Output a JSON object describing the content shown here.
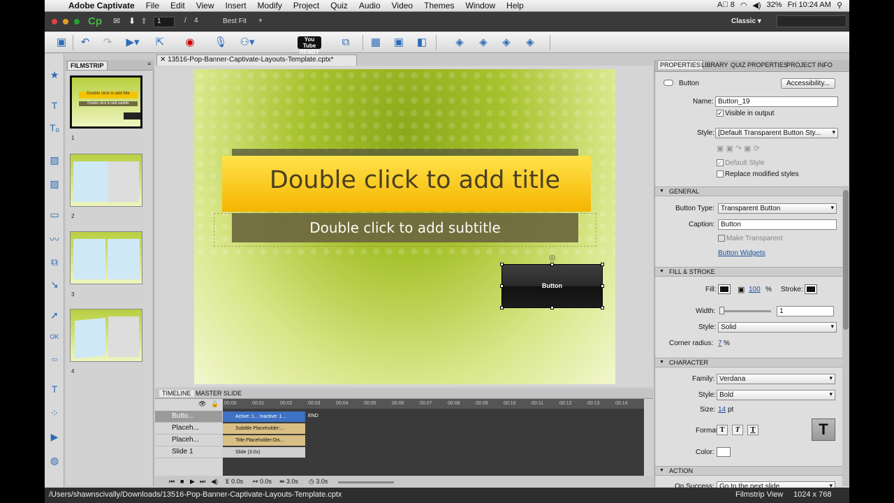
{
  "menubar": {
    "app": "Adobe Captivate",
    "items": [
      "File",
      "Edit",
      "View",
      "Insert",
      "Modify",
      "Project",
      "Quiz",
      "Audio",
      "Video",
      "Themes",
      "Window",
      "Help"
    ],
    "status": {
      "adobe": "8",
      "battery": "32%",
      "clock": "Fri 10:24 AM"
    }
  },
  "appbar": {
    "logo": "Cp",
    "slide_current": "1",
    "slide_sep": "/",
    "slide_total": "4",
    "zoom": "Best Fit",
    "workspace": "Classic"
  },
  "toolbar": {
    "youtube": "You Tube READY"
  },
  "filmstrip": {
    "tab": "FILMSTRIP",
    "slides": [
      {
        "num": "1",
        "title": "Double click to add title",
        "subtitle": "Double click to add subtitle"
      },
      {
        "num": "2"
      },
      {
        "num": "3"
      },
      {
        "num": "4"
      }
    ]
  },
  "document": {
    "tab": "13516-Pop-Banner-Captivate-Layouts-Template.cptx*",
    "title": "Double click to add title",
    "subtitle": "Double click to add subtitle",
    "button": "Button"
  },
  "timeline": {
    "tabs": [
      "TIMELINE",
      "MASTER SLIDE"
    ],
    "rows": [
      {
        "name": "Butto...",
        "bar": "Active: 1...   Inactive: 1...",
        "end": "END"
      },
      {
        "name": "Placeh...",
        "bar": "Subtitle Placeholder:..."
      },
      {
        "name": "Placeh...",
        "bar": "Title Placeholder:Dis..."
      },
      {
        "name": "Slide 1",
        "bar": "Slide (3.0s)"
      }
    ],
    "ruler": [
      "00:00",
      "00:01",
      "00:02",
      "00:03",
      "00:04",
      "00:05",
      "00:06",
      "00:07",
      "00:08",
      "00:09",
      "00:10",
      "00:11",
      "00:12",
      "00:13",
      "00:14"
    ],
    "footer": {
      "t1": "0.0s",
      "t2": "0.0s",
      "t3": "3.0s",
      "t4": "3.0s"
    }
  },
  "properties": {
    "tabs": [
      "PROPERTIES",
      "LIBRARY",
      "QUIZ PROPERTIES",
      "PROJECT INFO"
    ],
    "type": "Button",
    "accessibility": "Accessibility...",
    "name_label": "Name:",
    "name": "Button_19",
    "visible": "Visible in output",
    "style_label": "Style:",
    "style": "[Default Transparent Button Sty...",
    "default_style": "Default Style",
    "replace_styles": "Replace modified styles",
    "general": {
      "header": "GENERAL",
      "button_type_label": "Button Type:",
      "button_type": "Transparent Button",
      "caption_label": "Caption:",
      "caption": "Button",
      "make_transparent": "Make Transparent",
      "widgets": "Button Widgets"
    },
    "fill": {
      "header": "FILL & STROKE",
      "fill_label": "Fill:",
      "alpha": "100",
      "pct": "%",
      "stroke_label": "Stroke:",
      "width_label": "Width:",
      "width": "1",
      "style_label": "Style:",
      "style": "Solid",
      "corner_label": "Corner radius:",
      "corner": "7",
      "corner_pct": "%"
    },
    "character": {
      "header": "CHARACTER",
      "family_label": "Family:",
      "family": "Verdana",
      "style_label": "Style:",
      "style": "Bold",
      "size_label": "Size:",
      "size": "14",
      "size_unit": "pt",
      "format_label": "Format:",
      "fmt_t": "T",
      "color_label": "Color:"
    },
    "action": {
      "header": "ACTION",
      "on_success": "On Success:",
      "on_success_value": "Go to the next slide"
    }
  },
  "statusbar": {
    "path": "/Users/shawnscivally/Downloads/13516-Pop-Banner-Captivate-Layouts-Template.cptx",
    "view": "Filmstrip View",
    "size": "1024 x 768"
  }
}
